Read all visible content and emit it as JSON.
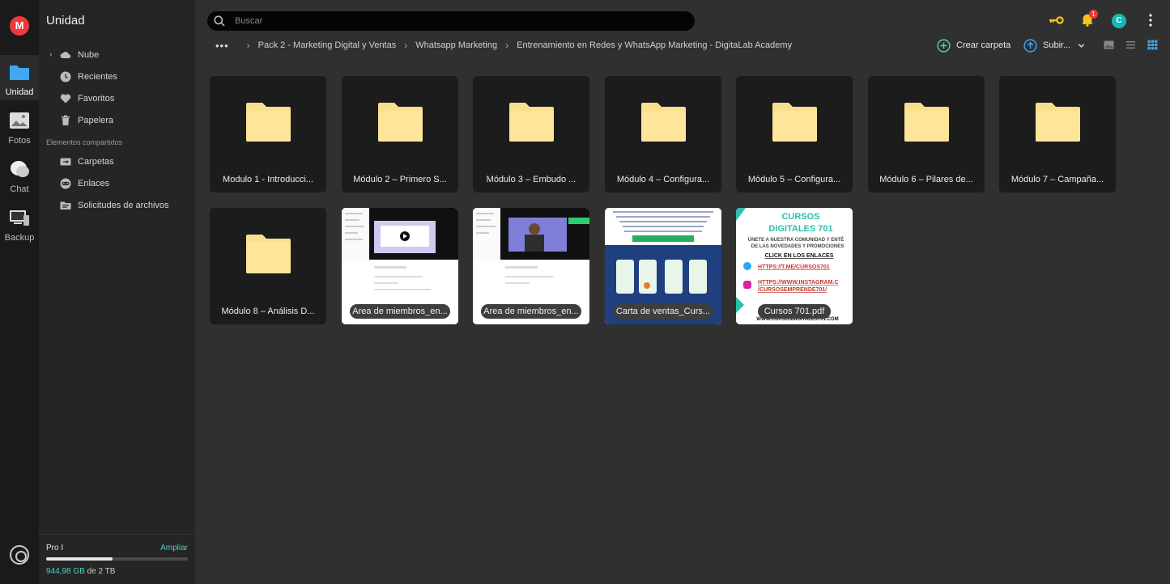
{
  "rail": {
    "logo": "M",
    "items": [
      {
        "label": "Unidad"
      },
      {
        "label": "Fotos"
      },
      {
        "label": "Chat"
      },
      {
        "label": "Backup"
      }
    ]
  },
  "sidebar": {
    "title": "Unidad",
    "items": [
      {
        "label": "Nube"
      },
      {
        "label": "Recientes"
      },
      {
        "label": "Favoritos"
      },
      {
        "label": "Papelera"
      }
    ],
    "shared_label": "Elementos compartidos",
    "shared_items": [
      {
        "label": "Carpetas"
      },
      {
        "label": "Enlaces"
      },
      {
        "label": "Solicitudes de archivos"
      }
    ],
    "storage": {
      "plan": "Pro I",
      "upgrade": "Ampliar",
      "used": "944,98 GB",
      "total_text": "de 2 TB",
      "fraction": 0.47
    }
  },
  "search": {
    "placeholder": "Buscar"
  },
  "topbar": {
    "notifications": "1",
    "avatar": "C"
  },
  "breadcrumb": {
    "dots": "•••",
    "items": [
      "Pack 2 - Marketing Digital y Ventas",
      "Whatsapp Marketing",
      "Entrenamiento en Redes y WhatsApp Marketing - DigitaLab Academy"
    ]
  },
  "toolbar": {
    "create_folder": "Crear carpeta",
    "upload": "Subir..."
  },
  "folders": [
    "Modulo 1 - Introducci...",
    "Módulo 2 – Primero S...",
    "Módulo 3 – Embudo ...",
    "Módulo 4 – Configura...",
    "Módulo 5 – Configura...",
    "Módulo 6 – Pilares de...",
    "Módulo 7 – Campaña...",
    "Módulo 8 – Análisis D..."
  ],
  "files": [
    {
      "name": "Area de miembros_en...",
      "thumb": "video"
    },
    {
      "name": "Area de miembros_en...",
      "thumb": "video-person"
    },
    {
      "name": "Carta de ventas_Curs...",
      "thumb": "sales"
    },
    {
      "name": "Cursos 701.pdf",
      "thumb": "pdf",
      "pdf_text": {
        "title1": "CURSOS",
        "title2": "DIGITALES 701",
        "line1": "ÚNETE A NUESTRA COMUNIDAD Y ENTÉ",
        "line2": "DE LAS NOVEDADES Y PROMOCIONES",
        "cta": "CLICK EN LOS ENLACES",
        "link1": "HTTPS://T.ME/CURSOS701",
        "link2a": "HTTPS://WWW.INSTAGRAM.C",
        "link2b": "/CURSOSEMPRENDE701/",
        "footer": "WWW.CURSOSDIGITALES701.COM"
      }
    }
  ],
  "colors": {
    "folder": "#f9e08e",
    "accent": "#4ed0c3",
    "brand": "#f0373a"
  }
}
